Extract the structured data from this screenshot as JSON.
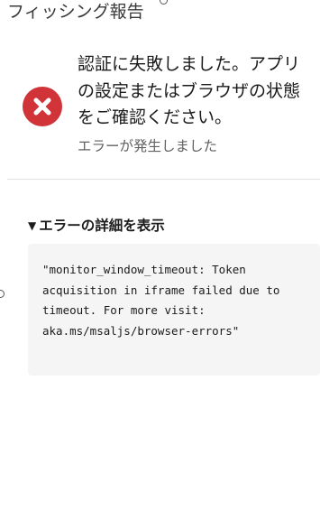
{
  "window": {
    "title": "フィッシング報告"
  },
  "error": {
    "icon": "error-circle-icon",
    "icon_color": "#d13438",
    "message": "認証に失敗しました。アプリの設定またはブラウザの状態をご確認ください。",
    "subtext": "エラーが発生しました"
  },
  "details": {
    "toggle_icon": "caret-down-icon",
    "toggle_label": "エラーの詳細を表示",
    "text": "\"monitor_window_timeout: Token acquisition in iframe failed due to timeout.  For more visit: aka.ms/msaljs/browser-errors\""
  }
}
